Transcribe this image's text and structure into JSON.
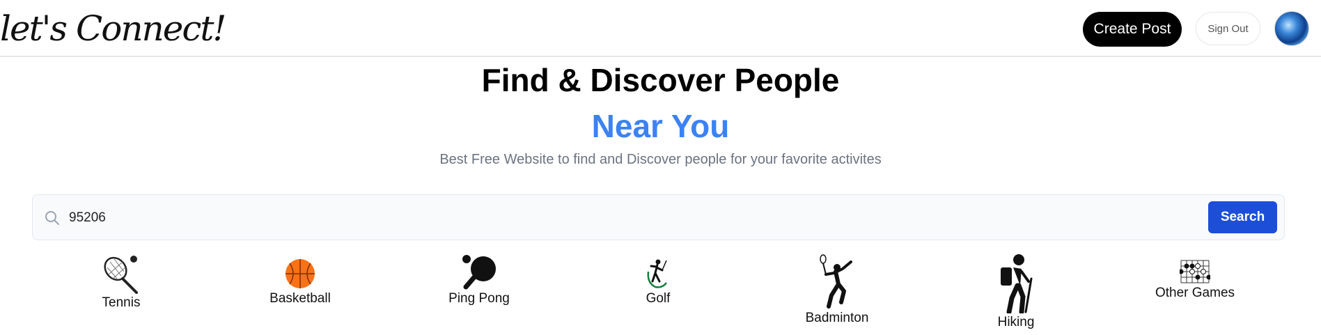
{
  "header": {
    "logo_text": "let's Connect!",
    "create_post_label": "Create Post",
    "sign_out_label": "Sign Out"
  },
  "hero": {
    "title": "Find & Discover People",
    "subtitle": "Near You",
    "tagline": "Best Free Website to find and Discover people for your favorite activites"
  },
  "search": {
    "value": "95206",
    "button_label": "Search"
  },
  "activities": [
    {
      "label": "Tennis",
      "icon": "tennis-icon"
    },
    {
      "label": "Basketball",
      "icon": "basketball-icon"
    },
    {
      "label": "Ping Pong",
      "icon": "ping-pong-icon"
    },
    {
      "label": "Golf",
      "icon": "golf-icon"
    },
    {
      "label": "Badminton",
      "icon": "badminton-icon"
    },
    {
      "label": "Hiking",
      "icon": "hiking-icon"
    },
    {
      "label": "Other Games",
      "icon": "board-game-icon"
    }
  ],
  "colors": {
    "accent": "#3b82f6",
    "search_button": "#1d4ed8",
    "create_post": "#000000"
  }
}
